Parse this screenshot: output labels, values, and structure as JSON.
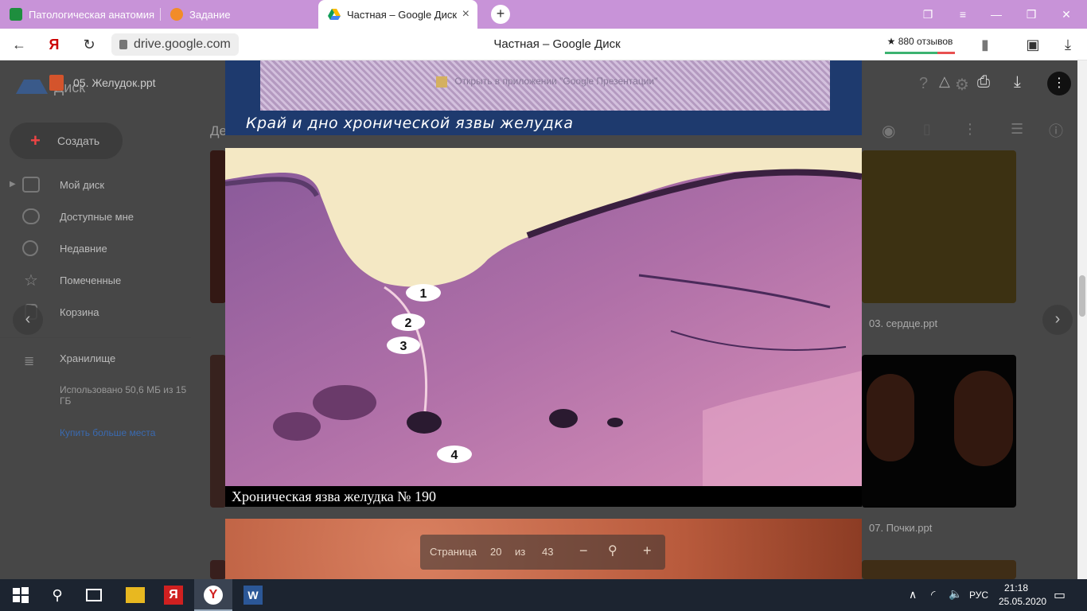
{
  "browser": {
    "tabs": [
      {
        "label": "Патологическая анатомия",
        "icon": "sheets-icon",
        "color": "#1e8e3e"
      },
      {
        "label": "Задание",
        "icon": "moodle-icon",
        "color": "#f28c28"
      },
      {
        "label": "Частная – Google Диск",
        "icon": "google-drive-icon",
        "active": true
      }
    ],
    "new_tab_label": "+",
    "url": "drive.google.com",
    "page_title": "Частная – Google Диск",
    "reviews": "★ 880 отзывов",
    "accent": "#c893d8"
  },
  "drive": {
    "file_title": "05. Желудок.ppt",
    "app_name": "Диск",
    "create_label": "Создать",
    "partial_text": "Де",
    "sidebar": [
      {
        "label": "Мой диск",
        "icon": "my-drive-icon"
      },
      {
        "label": "Доступные мне",
        "icon": "shared-icon"
      },
      {
        "label": "Недавние",
        "icon": "clock-icon"
      },
      {
        "label": "Помеченные",
        "icon": "star-icon"
      },
      {
        "label": "Корзина",
        "icon": "trash-icon"
      }
    ],
    "storage_label": "Хранилище",
    "storage_used": "Использовано 50,6 МБ из 15 ГБ",
    "buy_more": "Купить больше места",
    "files": [
      "03. сердце.ppt",
      "07. Почки.ppt"
    ]
  },
  "viewer": {
    "top_slide_caption": "Край и дно хронической язвы желудка",
    "open_in_app": "Открыть в приложении \"Google Презентации\"",
    "main_slide_caption": "Хроническая язва желудка № 190",
    "markers": [
      "1",
      "2",
      "3",
      "4"
    ],
    "pager": {
      "page_label": "Страница",
      "current": "20",
      "of_label": "из",
      "total": "43",
      "minus": "−",
      "plus": "+"
    }
  },
  "taskbar": {
    "language": "РУС",
    "time": "21:18",
    "date": "25.05.2020"
  }
}
